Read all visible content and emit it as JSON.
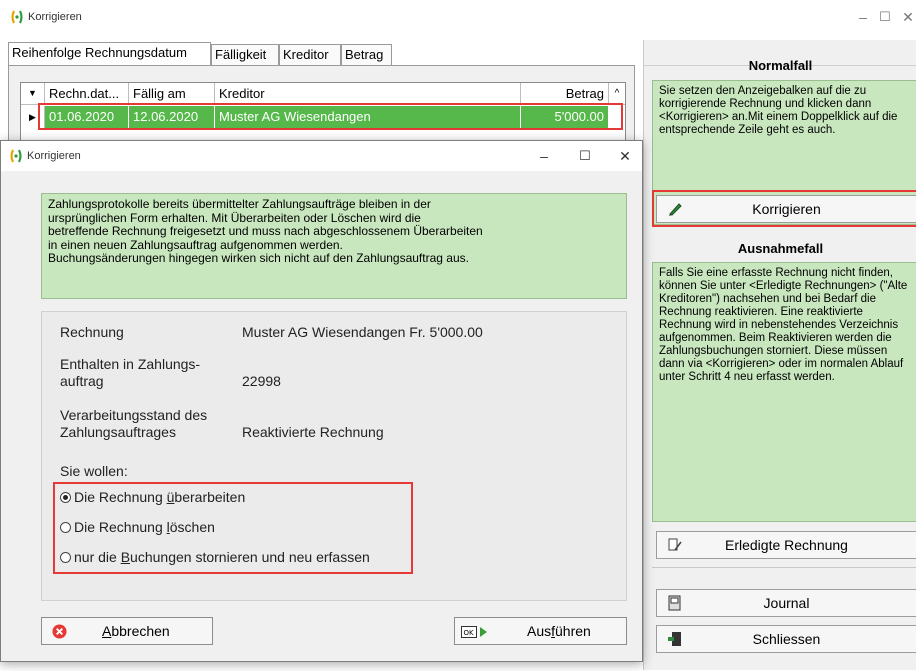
{
  "window": {
    "title": "Korrigieren",
    "minimize": "–",
    "maximize": "☐",
    "close": "✕"
  },
  "tabs": [
    {
      "label": "Reihenfolge Rechnungsdatum"
    },
    {
      "label": "Fälligkeit"
    },
    {
      "label": "Kreditor"
    },
    {
      "label": "Betrag"
    }
  ],
  "grid": {
    "headers": [
      "Rechn.dat...",
      "Fällig am",
      "Kreditor",
      "Betrag"
    ],
    "row": {
      "rechn": "01.06.2020",
      "faellig": "12.06.2020",
      "kreditor": "Muster AG Wiesendangen",
      "betrag": "5'000.00"
    }
  },
  "right": {
    "normal_title": "Normalfall",
    "normal_text": "Sie setzen den Anzeigebalken auf die zu korrigierende Rechnung und klicken dann <Korrigieren> an.Mit einem Doppelklick auf die entsprechende Zeile geht es auch.",
    "korrigieren": "Korrigieren",
    "ausnahme_title": "Ausnahmefall",
    "ausnahme_text": "Falls Sie eine erfasste Rechnung nicht finden, können Sie unter <Erledigte Rechnungen> (\"Alte Kreditoren\") nachsehen und bei Bedarf die Rechnung reaktivieren. Eine reaktivierte Rechnung wird in nebenstehendes Verzeichnis aufgenommen. Beim Reaktivieren werden die Zahlungsbuchungen storniert. Diese müssen dann via <Korrigieren> oder im normalen Ablauf unter Schritt 4 neu erfasst werden.",
    "erledigte": "Erledigte Rechnung",
    "journal": "Journal",
    "schliessen": "Schliessen"
  },
  "dialog": {
    "title": "Korrigieren",
    "info": "Zahlungsprotokolle bereits übermittelter Zahlungsaufträge bleiben in der\nursprünglichen Form erhalten. Mit Überarbeiten oder Löschen wird die\nbetreffende Rechnung freigesetzt und muss nach abgeschlossenem Überarbeiten\nin einen neuen Zahlungsauftrag aufgenommen werden.\nBuchungsänderungen hingegen wirken sich nicht auf den Zahlungsauftrag aus.",
    "rechnung_label": "Rechnung",
    "rechnung_value": "Muster AG Wiesendangen Fr.  5'000.00",
    "enthalten_label_1": "Enthalten in Zahlungs-",
    "enthalten_label_2": "auftrag",
    "enthalten_value": "22998",
    "stand_label_1": "Verarbeitungsstand des",
    "stand_label_2": "Zahlungsauftrages",
    "stand_value": "Reaktivierte Rechnung",
    "sie_wollen": "Sie wollen:",
    "opt1_a": "Die Rechnung ",
    "opt1_u": "ü",
    "opt1_b": "berarbeiten",
    "opt2_a": "Die Rechnung ",
    "opt2_u": "l",
    "opt2_b": "öschen",
    "opt3_a": "nur die ",
    "opt3_u": "B",
    "opt3_b": "uchungen stornieren und neu erfassen",
    "abbrechen_u": "A",
    "abbrechen_b": "bbrechen",
    "ausfuehren_a": "Aus",
    "ausfuehren_u": "f",
    "ausfuehren_b": "ühren"
  },
  "colors": {
    "accent_green": "#56b84a",
    "info_green": "#c9e7bf",
    "highlight_red": "#e53935"
  }
}
